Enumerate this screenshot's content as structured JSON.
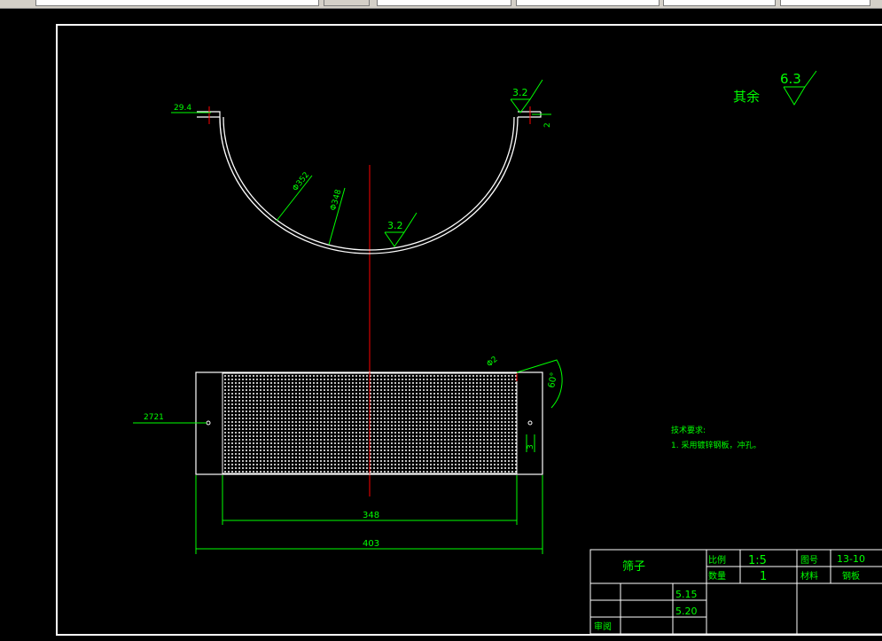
{
  "drawing": {
    "dims_top": {
      "left_offset": "29.4",
      "right_finish": "3.2",
      "right_small": "2",
      "outer_dia": "Φ352",
      "inner_dia": "Φ348",
      "bottom_finish": "3.2"
    },
    "general_finish": {
      "label": "其余",
      "value": "6.3"
    },
    "dims_bottom": {
      "left_offset": "2721",
      "angle": "60°",
      "hole": "Φ2",
      "right_small": "3",
      "width_inner": "348",
      "width_outer": "403"
    },
    "notes": {
      "title": "技术要求:",
      "item1": "1. 采用镀锌钢板，冲孔。"
    }
  },
  "title_block": {
    "part_name": "筛子",
    "scale_label": "比例",
    "scale_value": "1:5",
    "qty_label": "数量",
    "qty_value": "1",
    "drawing_no_label": "图号",
    "drawing_no_value": "13-10",
    "material_label": "材料",
    "material_value": "钢板",
    "date1": "5.15",
    "date2": "5.20",
    "reviewer_label": "审阅"
  },
  "colors": {
    "background": "#000000",
    "outline": "#ffffff",
    "dimension": "#00ff00",
    "centerline": "#ff0000",
    "toolbar": "#d4d0c8"
  }
}
